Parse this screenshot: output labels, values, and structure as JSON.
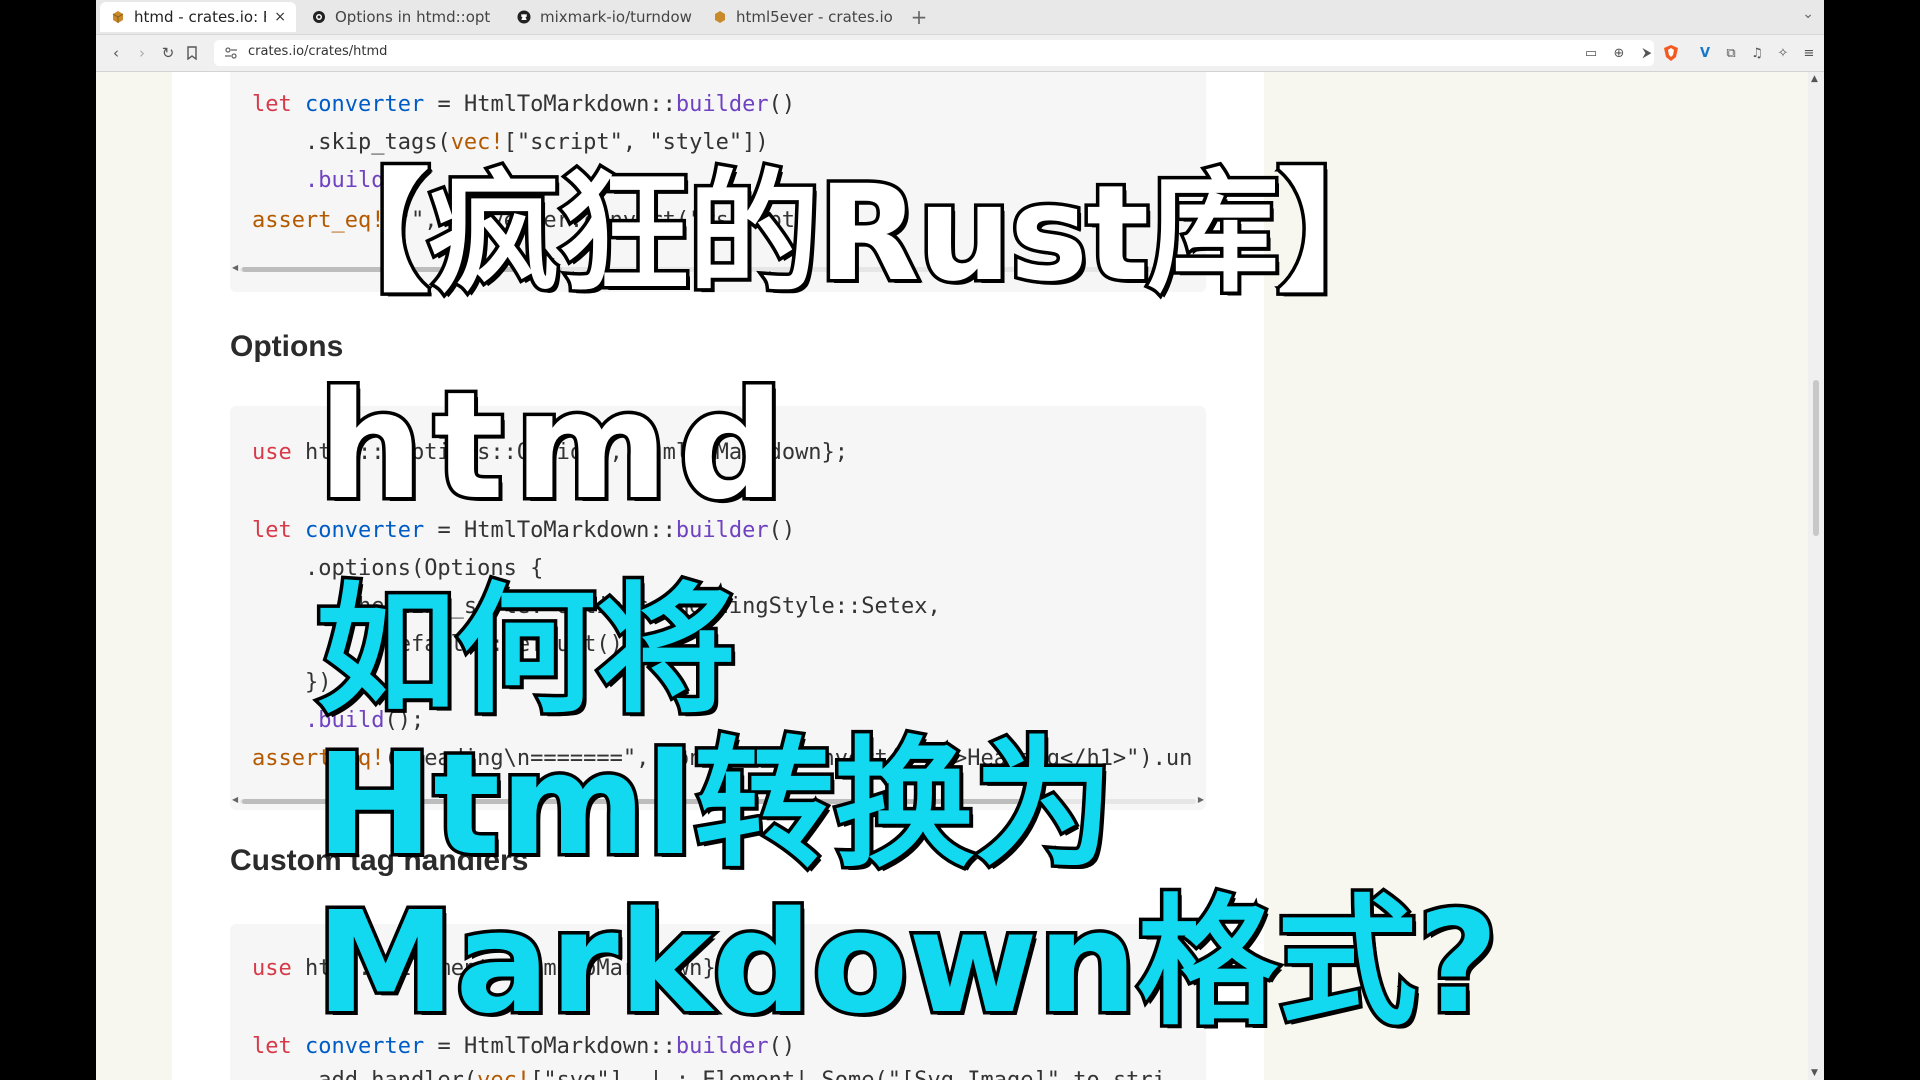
{
  "tabs": [
    {
      "title": "htmd - crates.io: R",
      "active": true,
      "favicon": "crate-icon"
    },
    {
      "title": "Options in htmd::opt",
      "active": false,
      "favicon": "docs-icon"
    },
    {
      "title": "mixmark-io/turndow",
      "active": false,
      "favicon": "github-icon"
    },
    {
      "title": "html5ever - crates.io",
      "active": false,
      "favicon": "crate-icon"
    }
  ],
  "tab_close": "×",
  "new_tab": "+",
  "address": {
    "url": "crates.io/crates/htmd"
  },
  "page": {
    "code1": {
      "line1": {
        "kw": "let",
        "id": "converter",
        "op": " = HtmlToMarkdown::",
        "fn": "builder",
        "end": "()"
      },
      "line2": {
        "pre": ".skip_tags(",
        "mac": "vec!",
        "rest": "[\"script\", \"style\"])"
      },
      "line3": {
        "fn": ".build"
      },
      "line4": {
        "mac": "assert_eq!",
        "rest": "(\"\", converter.convert(\"<script>"
      }
    },
    "heading_options": "Options",
    "code2": {
      "line1": {
        "kw": "use",
        "rest": " htmd::{options::Options, HtmlToMarkdown};"
      },
      "line2": {
        "kw": "let",
        "id": "converter",
        "op": " = HtmlToMarkdown::",
        "fn": "builder",
        "end": "()"
      },
      "line3": {
        "text": ".options(Options {"
      },
      "line4": {
        "text": "heading_style: options::HeadingStyle::Setex,"
      },
      "line5": {
        "text": "..Default::default()"
      },
      "line6": {
        "text": "})"
      },
      "line7": {
        "fn": ".build",
        "end": "();"
      },
      "line8": {
        "mac": "assert_eq!",
        "rest": "(\"Heading\\n=======\", converter.convert(\"<h1>Heading</h1>\").un"
      }
    },
    "heading_custom": "Custom tag handlers",
    "code3": {
      "line1": {
        "kw": "use",
        "rest": " htmd::{Element, HtmlToMarkdown};"
      },
      "line2": {
        "kw": "let",
        "id": "converter",
        "op": " = HtmlToMarkdown::",
        "fn": "builder",
        "end": "()"
      },
      "line3": {
        "pre": ".add_handler(",
        "mac": "vec!",
        "rest": "[\"svg\"], |_: Element| Some(\"[Svg Image]\".to_stri"
      }
    }
  },
  "overlay": {
    "line1": "【疯狂的Rust库】",
    "line2": "htmd",
    "line3": "如何将",
    "line4": "Html转换为",
    "line5": "Markdown格式?"
  },
  "colors": {
    "overlay_white": "#ffffff",
    "overlay_cyan": "#12d8f0",
    "overlay_stroke": "#000000"
  }
}
